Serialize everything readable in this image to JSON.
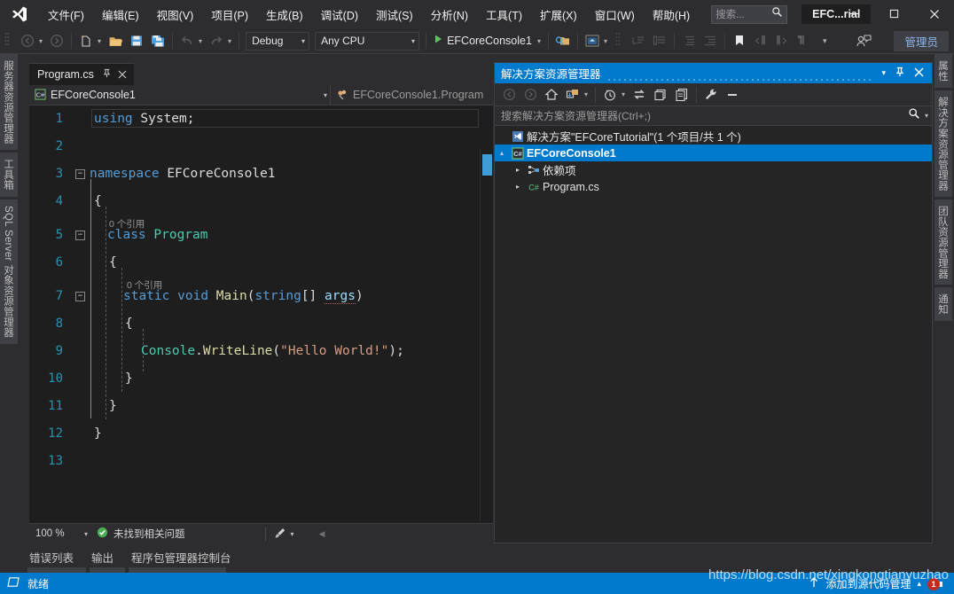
{
  "app": {
    "window_title": "EFC...rial",
    "logo_icon": "visual-studio-logo"
  },
  "menu": {
    "items": [
      {
        "label": "文件(F)"
      },
      {
        "label": "编辑(E)"
      },
      {
        "label": "视图(V)"
      },
      {
        "label": "项目(P)"
      },
      {
        "label": "生成(B)"
      },
      {
        "label": "调试(D)"
      },
      {
        "label": "测试(S)"
      },
      {
        "label": "分析(N)"
      },
      {
        "label": "工具(T)"
      },
      {
        "label": "扩展(X)"
      },
      {
        "label": "窗口(W)"
      },
      {
        "label": "帮助(H)"
      }
    ],
    "search_placeholder": "搜索...",
    "search_icon": "magnifier-icon"
  },
  "window_controls": {
    "minimize": "—",
    "maximize": "☐",
    "close": "✕"
  },
  "toolbar": {
    "navigate_back_icon": "arrow-back-icon",
    "navigate_forward_icon": "arrow-forward-icon",
    "new_project_icon": "new-project-icon",
    "open_file_icon": "open-folder-icon",
    "save_icon": "save-icon",
    "save_all_icon": "save-all-icon",
    "undo_icon": "undo-icon",
    "redo_icon": "redo-icon",
    "configuration": "Debug",
    "platform": "Any CPU",
    "start_label": "EFCoreConsole1",
    "start_icon": "play-triangle-icon",
    "find_icon": "find-in-files-icon",
    "preview_icon": "preview-icon",
    "admin_label": "管理员",
    "feedback_icon": "feedback-icon",
    "bookmark_icon": "bookmark-icon"
  },
  "left_dock": {
    "tabs": [
      {
        "label": "服务器资源管理器"
      },
      {
        "label": "工具箱"
      },
      {
        "label": "SQL Server 对象资源管理器"
      }
    ]
  },
  "right_dock": {
    "tabs": [
      {
        "label": "属性"
      },
      {
        "label": "解决方案资源管理器"
      },
      {
        "label": "团队资源管理器"
      },
      {
        "label": "通知"
      }
    ]
  },
  "editor": {
    "tab_label": "Program.cs",
    "pin_icon": "pin-icon",
    "close_icon": "close-icon",
    "nav_project": "EFCoreConsole1",
    "nav_project_icon": "csharp-file-icon",
    "nav_member": "EFCoreConsole1.Program",
    "nav_member_icon": "class-icon",
    "line_numbers": [
      "1",
      "2",
      "3",
      "4",
      "5",
      "6",
      "7",
      "8",
      "9",
      "10",
      "11",
      "12",
      "13"
    ],
    "codelens_class": "0 个引用",
    "codelens_method": "0 个引用",
    "code_lines": [
      "using System;",
      "",
      "namespace EFCoreConsole1",
      "{",
      "    class Program",
      "    {",
      "        static void Main(string[] args)",
      "        {",
      "            Console.WriteLine(\"Hello World!\");",
      "        }",
      "    }",
      "}",
      ""
    ],
    "zoom_level": "100 %",
    "issues_status": "未找到相关问题",
    "issues_icon": "check-circle-icon",
    "brush_icon": "brush-icon"
  },
  "solution_explorer": {
    "title": "解决方案资源管理器",
    "dropdown_icon": "chevron-down-icon",
    "pin_icon": "pin-icon",
    "close_icon": "close-icon",
    "toolbar": {
      "back_icon": "arrow-back-icon",
      "forward_icon": "arrow-forward-icon",
      "home_icon": "home-icon",
      "pending_changes_icon": "pending-changes-icon",
      "history_icon": "history-clock-icon",
      "sync_icon": "sync-icon",
      "collapse_all_icon": "collapse-all-icon",
      "show_all_files_icon": "show-all-files-icon",
      "properties_icon": "wrench-icon",
      "preview_icon": "preview-selected-icon"
    },
    "search_placeholder": "搜索解决方案资源管理器(Ctrl+;)",
    "search_icon": "magnifier-icon",
    "tree": [
      {
        "label": "解决方案\"EFCoreTutorial\"(1 个项目/共 1 个)",
        "icon": "solution-icon",
        "arrow": "",
        "indent": 8,
        "selected": false
      },
      {
        "label": "EFCoreConsole1",
        "icon": "csharp-project-icon",
        "arrow": "▴",
        "indent": 8,
        "selected": true
      },
      {
        "label": "依赖项",
        "icon": "dependencies-icon",
        "arrow": "▸",
        "indent": 26,
        "selected": false
      },
      {
        "label": "Program.cs",
        "icon": "csharp-file-icon",
        "arrow": "▸",
        "indent": 26,
        "selected": false
      }
    ]
  },
  "bottom_tabs": {
    "items": [
      {
        "label": "错误列表"
      },
      {
        "label": "输出"
      },
      {
        "label": "程序包管理器控制台"
      }
    ]
  },
  "statusbar": {
    "status_icon": "ready-icon",
    "status_text": "就绪",
    "source_control_label": "添加到源代码管理",
    "source_control_up_icon": "arrow-up-icon",
    "source_control_caret_icon": "caret-up-icon",
    "notification_icon": "source-control-icon",
    "notification_count": "1"
  },
  "watermark": {
    "text": "https://blog.csdn.net/xingkongtianyuzhao"
  },
  "colors": {
    "accent": "#007acc",
    "chrome": "#2d2d30",
    "editor_bg": "#1e1e1e",
    "badge_red": "#c42b1c"
  }
}
